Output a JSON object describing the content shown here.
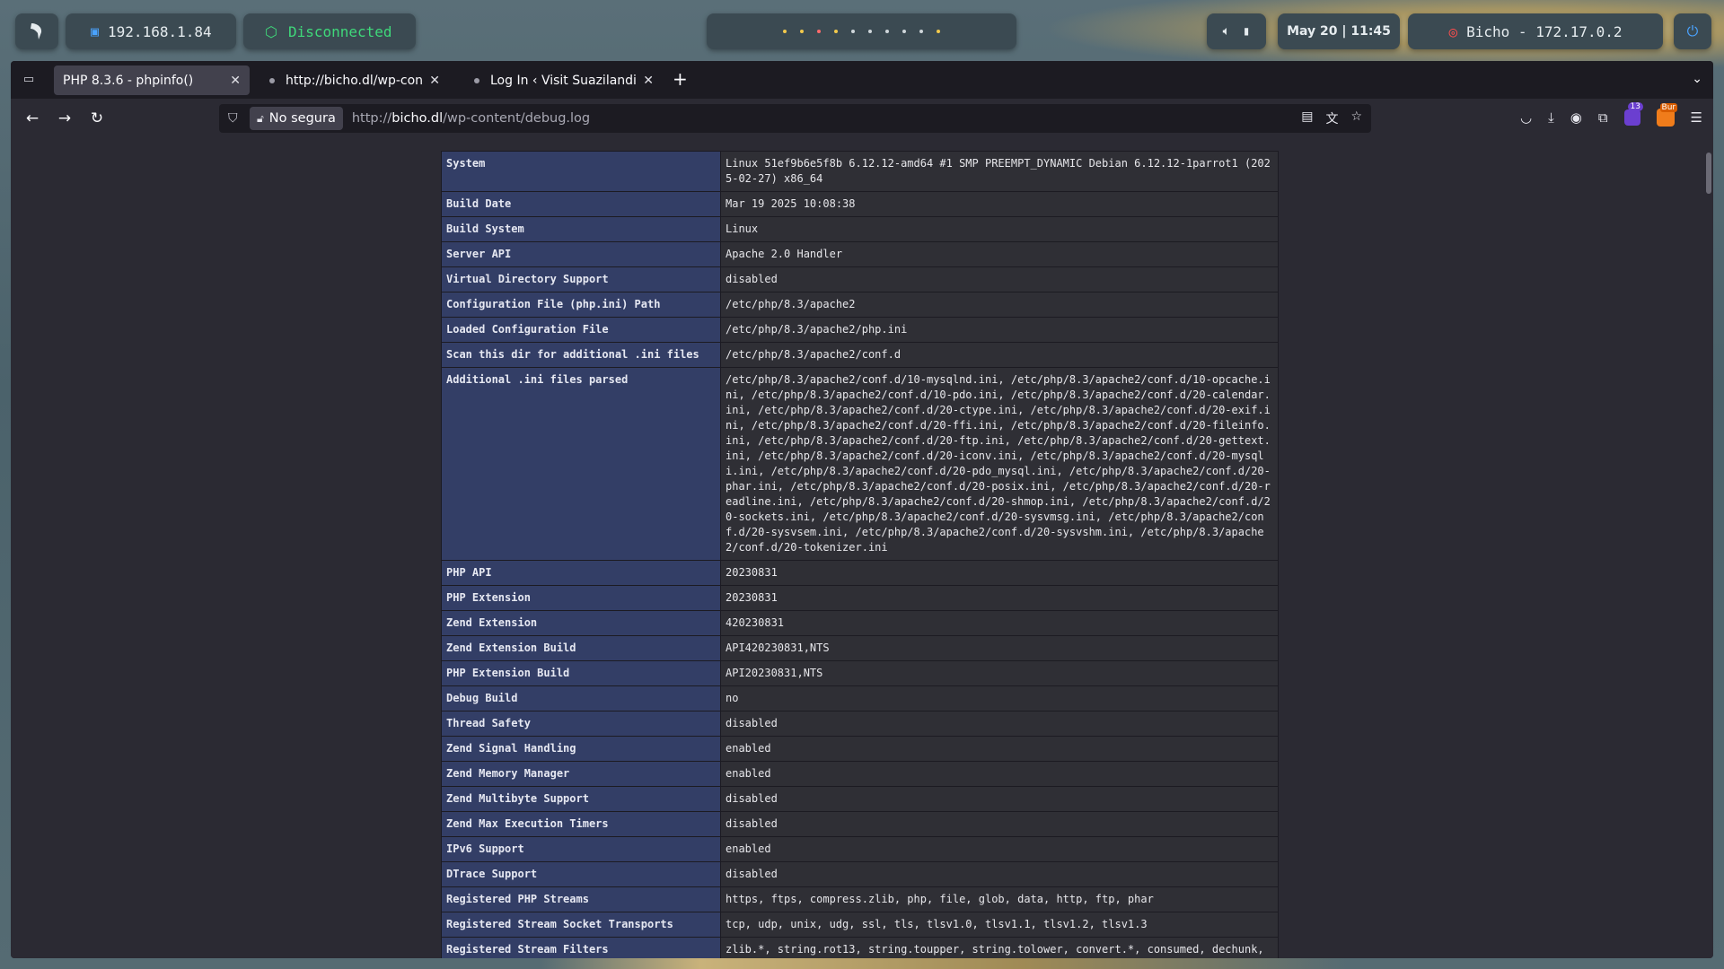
{
  "topbar": {
    "ip": "192.168.1.84",
    "vpn_status": "Disconnected",
    "clock": "May 20  |  11:45",
    "target": "Bicho - 172.17.0.2",
    "workspace_count": 10
  },
  "browser": {
    "tabs": [
      {
        "label": "PHP 8.3.6 - phpinfo()",
        "active": true
      },
      {
        "label": "http://bicho.dl/wp-conten",
        "active": false
      },
      {
        "label": "Log In ‹ Visit Suazilandia",
        "active": false
      }
    ],
    "url_warning": "No segura",
    "url_prefix": "http://",
    "url_host": "bicho.dl",
    "url_path": "/wp-content/debug.log",
    "extension_badge": "13",
    "burp_badge": "Bur"
  },
  "phpinfo": {
    "rows": [
      {
        "key": "System",
        "value": "Linux 51ef9b6e5f8b 6.12.12-amd64 #1 SMP PREEMPT_DYNAMIC Debian 6.12.12-1parrot1 (2025-02-27) x86_64"
      },
      {
        "key": "Build Date",
        "value": "Mar 19 2025 10:08:38"
      },
      {
        "key": "Build System",
        "value": "Linux"
      },
      {
        "key": "Server API",
        "value": "Apache 2.0 Handler"
      },
      {
        "key": "Virtual Directory Support",
        "value": "disabled"
      },
      {
        "key": "Configuration File (php.ini) Path",
        "value": "/etc/php/8.3/apache2"
      },
      {
        "key": "Loaded Configuration File",
        "value": "/etc/php/8.3/apache2/php.ini"
      },
      {
        "key": "Scan this dir for additional .ini files",
        "value": "/etc/php/8.3/apache2/conf.d"
      },
      {
        "key": "Additional .ini files parsed",
        "value": "/etc/php/8.3/apache2/conf.d/10-mysqlnd.ini, /etc/php/8.3/apache2/conf.d/10-opcache.ini, /etc/php/8.3/apache2/conf.d/10-pdo.ini, /etc/php/8.3/apache2/conf.d/20-calendar.ini, /etc/php/8.3/apache2/conf.d/20-ctype.ini, /etc/php/8.3/apache2/conf.d/20-exif.ini, /etc/php/8.3/apache2/conf.d/20-ffi.ini, /etc/php/8.3/apache2/conf.d/20-fileinfo.ini, /etc/php/8.3/apache2/conf.d/20-ftp.ini, /etc/php/8.3/apache2/conf.d/20-gettext.ini, /etc/php/8.3/apache2/conf.d/20-iconv.ini, /etc/php/8.3/apache2/conf.d/20-mysqli.ini, /etc/php/8.3/apache2/conf.d/20-pdo_mysql.ini, /etc/php/8.3/apache2/conf.d/20-phar.ini, /etc/php/8.3/apache2/conf.d/20-posix.ini, /etc/php/8.3/apache2/conf.d/20-readline.ini, /etc/php/8.3/apache2/conf.d/20-shmop.ini, /etc/php/8.3/apache2/conf.d/20-sockets.ini, /etc/php/8.3/apache2/conf.d/20-sysvmsg.ini, /etc/php/8.3/apache2/conf.d/20-sysvsem.ini, /etc/php/8.3/apache2/conf.d/20-sysvshm.ini, /etc/php/8.3/apache2/conf.d/20-tokenizer.ini"
      },
      {
        "key": "PHP API",
        "value": "20230831"
      },
      {
        "key": "PHP Extension",
        "value": "20230831"
      },
      {
        "key": "Zend Extension",
        "value": "420230831"
      },
      {
        "key": "Zend Extension Build",
        "value": "API420230831,NTS"
      },
      {
        "key": "PHP Extension Build",
        "value": "API20230831,NTS"
      },
      {
        "key": "Debug Build",
        "value": "no"
      },
      {
        "key": "Thread Safety",
        "value": "disabled"
      },
      {
        "key": "Zend Signal Handling",
        "value": "enabled"
      },
      {
        "key": "Zend Memory Manager",
        "value": "enabled"
      },
      {
        "key": "Zend Multibyte Support",
        "value": "disabled"
      },
      {
        "key": "Zend Max Execution Timers",
        "value": "disabled"
      },
      {
        "key": "IPv6 Support",
        "value": "enabled"
      },
      {
        "key": "DTrace Support",
        "value": "disabled"
      },
      {
        "key": "Registered PHP Streams",
        "value": "https, ftps, compress.zlib, php, file, glob, data, http, ftp, phar"
      },
      {
        "key": "Registered Stream Socket Transports",
        "value": "tcp, udp, unix, udg, ssl, tls, tlsv1.0, tlsv1.1, tlsv1.2, tlsv1.3"
      },
      {
        "key": "Registered Stream Filters",
        "value": "zlib.*, string.rot13, string.toupper, string.tolower, convert.*, consumed, dechunk, convert.iconv.*"
      }
    ]
  }
}
